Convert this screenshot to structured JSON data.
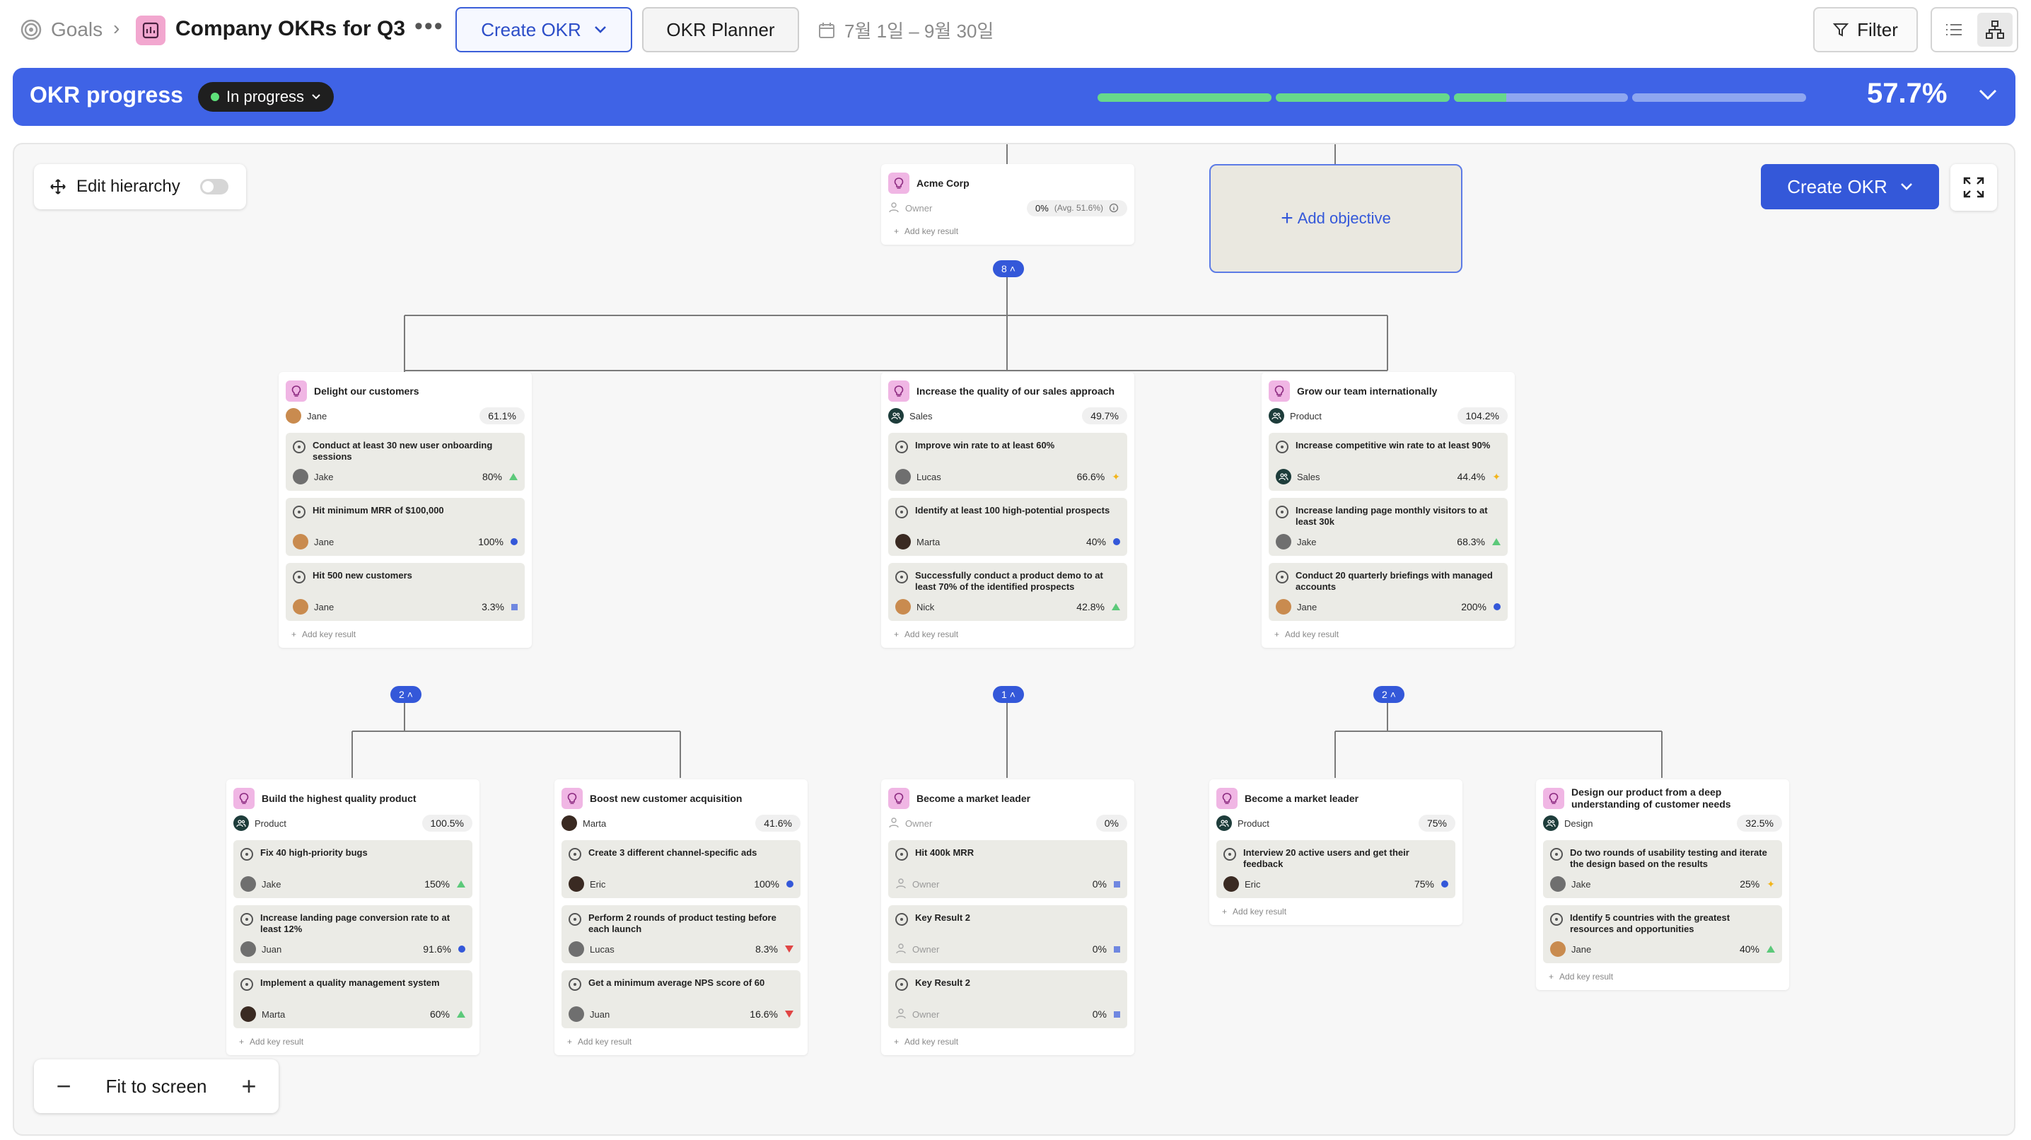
{
  "topbar": {
    "goals_label": "Goals",
    "page_title": "Company OKRs for Q3",
    "create_okr_label": "Create OKR",
    "planner_label": "OKR Planner",
    "date_range": "7월 1일 – 9월 30일",
    "filter_label": "Filter"
  },
  "banner": {
    "title": "OKR progress",
    "status": "In progress",
    "percent": "57.7%",
    "segments_fill": [
      1.0,
      1.0,
      0.3,
      0.0
    ]
  },
  "canvas": {
    "edit_hierarchy_label": "Edit hierarchy",
    "create_okr_label": "Create OKR",
    "fit_label": "Fit to screen",
    "add_objective_label": "Add objective",
    "add_key_result_label": "Add key result"
  },
  "root": {
    "title": "Acme Corp",
    "owner": "Owner",
    "percent": "0%",
    "avg": "(Avg. 51.6%)",
    "child_count": "8"
  },
  "objectives": {
    "delight": {
      "title": "Delight our customers",
      "owner": "Jane",
      "percent": "61.1%",
      "child_count": "2",
      "krs": [
        {
          "title": "Conduct at least 30 new user onboarding sessions",
          "owner": "Jake",
          "percent": "80%"
        },
        {
          "title": "Hit minimum MRR of $100,000",
          "owner": "Jane",
          "percent": "100%"
        },
        {
          "title": "Hit 500 new customers",
          "owner": "Jane",
          "percent": "3.3%"
        }
      ]
    },
    "sales": {
      "title": "Increase the quality of our sales approach",
      "owner": "Sales",
      "percent": "49.7%",
      "child_count": "1",
      "krs": [
        {
          "title": "Improve win rate to at least 60%",
          "owner": "Lucas",
          "percent": "66.6%"
        },
        {
          "title": "Identify at least 100 high-potential prospects",
          "owner": "Marta",
          "percent": "40%"
        },
        {
          "title": "Successfully conduct a product demo to at least 70% of the identified prospects",
          "owner": "Nick",
          "percent": "42.8%"
        }
      ]
    },
    "grow": {
      "title": "Grow our team internationally",
      "owner": "Product",
      "percent": "104.2%",
      "child_count": "2",
      "krs": [
        {
          "title": "Increase competitive win rate to at least 90%",
          "owner": "Sales",
          "percent": "44.4%"
        },
        {
          "title": "Increase landing page monthly visitors to at least 30k",
          "owner": "Jake",
          "percent": "68.3%"
        },
        {
          "title": "Conduct 20 quarterly briefings with managed accounts",
          "owner": "Jane",
          "percent": "200%"
        }
      ]
    },
    "quality": {
      "title": "Build the highest quality product",
      "owner": "Product",
      "percent": "100.5%",
      "krs": [
        {
          "title": "Fix 40 high-priority bugs",
          "owner": "Jake",
          "percent": "150%"
        },
        {
          "title": "Increase landing page conversion rate to at least 12%",
          "owner": "Juan",
          "percent": "91.6%"
        },
        {
          "title": "Implement a quality management system",
          "owner": "Marta",
          "percent": "60%"
        }
      ]
    },
    "acquisition": {
      "title": "Boost new customer acquisition",
      "owner": "Marta",
      "percent": "41.6%",
      "krs": [
        {
          "title": "Create 3 different channel-specific ads",
          "owner": "Eric",
          "percent": "100%"
        },
        {
          "title": "Perform 2 rounds of product testing before each launch",
          "owner": "Lucas",
          "percent": "8.3%"
        },
        {
          "title": "Get a minimum average NPS score of 60",
          "owner": "Juan",
          "percent": "16.6%"
        }
      ]
    },
    "leader1": {
      "title": "Become a market leader",
      "owner": "Owner",
      "percent": "0%",
      "krs": [
        {
          "title": "Hit 400k MRR",
          "owner": "Owner",
          "percent": "0%"
        },
        {
          "title": "Key Result 2",
          "owner": "Owner",
          "percent": "0%"
        },
        {
          "title": "Key Result 2",
          "owner": "Owner",
          "percent": "0%"
        }
      ]
    },
    "leader2": {
      "title": "Become a market leader",
      "owner": "Product",
      "percent": "75%",
      "krs": [
        {
          "title": "Interview 20 active users and get their feedback",
          "owner": "Eric",
          "percent": "75%"
        }
      ]
    },
    "design": {
      "title": "Design our product from a deep understanding of customer needs",
      "owner": "Design",
      "percent": "32.5%",
      "krs": [
        {
          "title": "Do two rounds of usability testing and iterate the design based on the results",
          "owner": "Jake",
          "percent": "25%"
        },
        {
          "title": "Identify 5 countries with the greatest resources and opportunities",
          "owner": "Jane",
          "percent": "40%"
        }
      ]
    }
  },
  "colors": {
    "brand_blue": "#3f63e6",
    "progress_green": "#67d88b",
    "objective_icon": "#f0b6e4"
  }
}
